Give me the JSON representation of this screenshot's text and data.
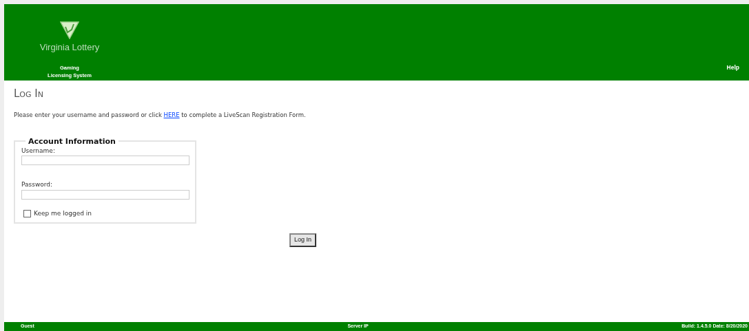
{
  "header": {
    "logo_text": "Virginia Lottery",
    "system_name": [
      "Gaming",
      "Licensing System"
    ],
    "help": "Help"
  },
  "page_title": "Log In",
  "intro": {
    "before": "Please enter your username and password or click ",
    "link": "HERE",
    "after": " to complete a LiveScan Registration Form."
  },
  "account": {
    "legend": "Account Information",
    "fields": [
      {
        "label": "Username:"
      },
      {
        "label": "Password:"
      }
    ],
    "keep_logged_in": {
      "label": "Keep me logged in",
      "checked": false
    }
  },
  "login_button": "Log In",
  "footer": {
    "user": "Guest",
    "server": "Server IP",
    "build": "Build: 1.4.5.0  Date: 8/20/2020"
  }
}
